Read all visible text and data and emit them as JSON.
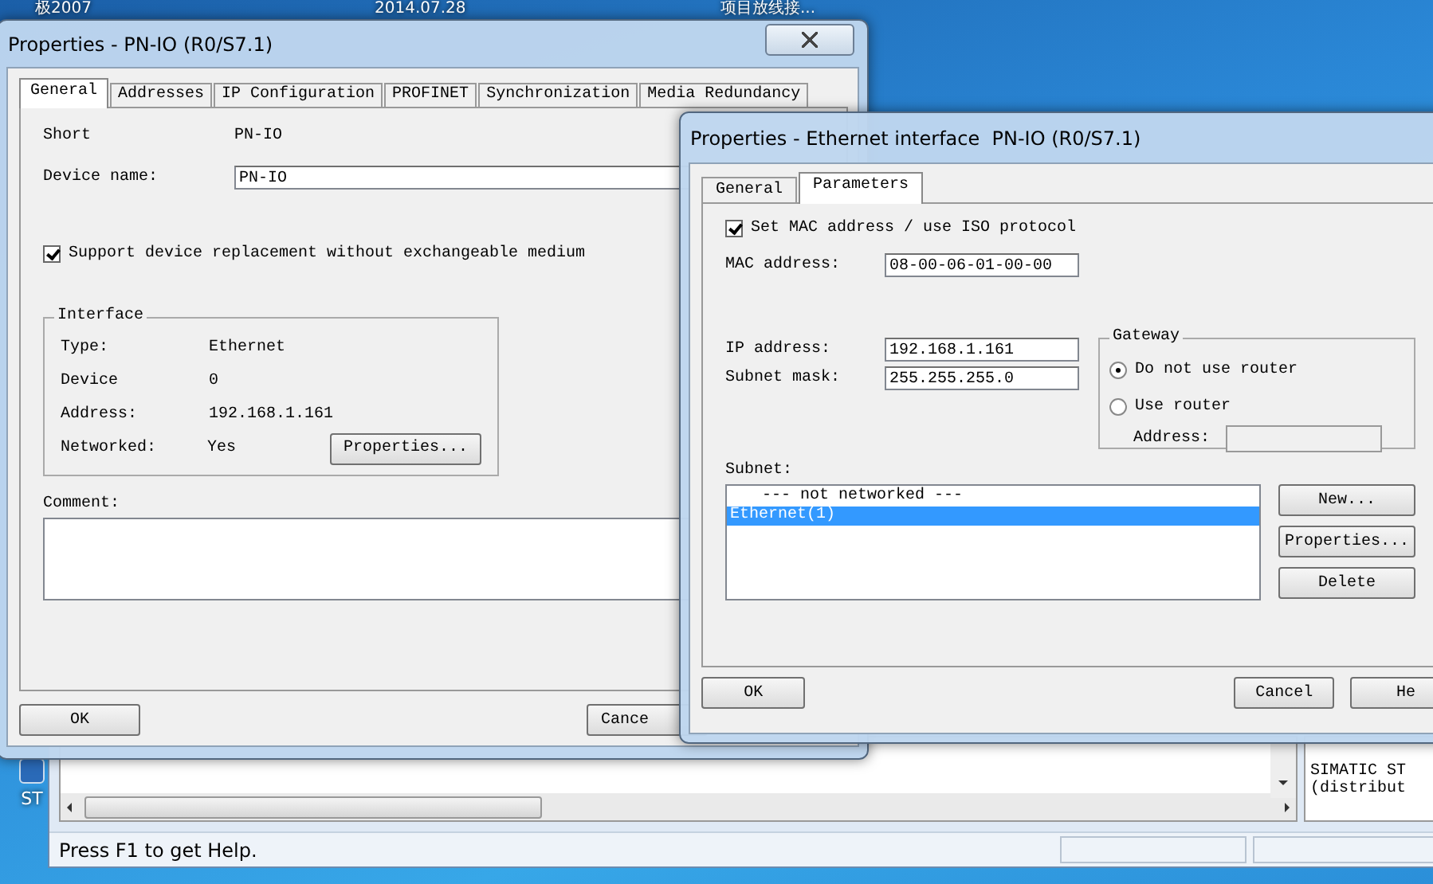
{
  "desktop_labels": [
    "极2007",
    "2014.07.28",
    "项目放线接..."
  ],
  "desktop_icon": {
    "label": "ST"
  },
  "main_window": {
    "side_panel": [
      "SIMATIC ST",
      "(distribut"
    ],
    "status_bar": "Press F1 to get Help."
  },
  "general_dialog": {
    "title": "Properties - PN-IO (R0/S7.1)",
    "tabs": [
      {
        "label": "General",
        "selected": true
      },
      {
        "label": "Addresses",
        "selected": false
      },
      {
        "label": "IP Configuration",
        "selected": false
      },
      {
        "label": "PROFINET",
        "selected": false
      },
      {
        "label": "Synchronization",
        "selected": false
      },
      {
        "label": "Media Redundancy",
        "selected": false
      }
    ],
    "short": {
      "label": "Short",
      "value": "PN-IO"
    },
    "device_name": {
      "label": "Device name:",
      "value": "PN-IO"
    },
    "replacement": {
      "label": "Support device replacement without exchangeable medium",
      "checked": true
    },
    "interface": {
      "title": "Interface",
      "rows": [
        {
          "label": "Type:",
          "value": "Ethernet"
        },
        {
          "label": "Device",
          "value": "0"
        },
        {
          "label": "Address:",
          "value": "192.168.1.161"
        },
        {
          "label": "Networked:",
          "value": "Yes"
        }
      ],
      "button": "Properties..."
    },
    "comment_label": "Comment:",
    "buttons": [
      "OK",
      "Cance"
    ]
  },
  "ethernet_dialog": {
    "title": "Properties - Ethernet interface  PN-IO (R0/S7.1)",
    "tabs": [
      {
        "label": "General",
        "selected": false
      },
      {
        "label": "Parameters",
        "selected": true
      }
    ],
    "mac_option": {
      "label": "Set MAC address / use ISO protocol",
      "checked": true
    },
    "mac_address": {
      "label": "MAC address:",
      "value": "08-00-06-01-00-00"
    },
    "ip_address": {
      "label": "IP address:",
      "value": "192.168.1.161"
    },
    "subnet_mask": {
      "label": "Subnet mask:",
      "value": "255.255.255.0"
    },
    "gateway": {
      "title": "Gateway",
      "options": [
        {
          "label": "Do not use router",
          "selected": true
        },
        {
          "label": "Use router",
          "selected": false
        }
      ],
      "address_label": "Address:",
      "address_disabled": true
    },
    "subnet_label": "Subnet:",
    "subnets": [
      {
        "label": "--- not networked ---",
        "selected": false
      },
      {
        "label": "Ethernet(1)",
        "selected": true
      }
    ],
    "subnet_buttons": [
      "New...",
      "Properties...",
      "Delete"
    ],
    "buttons": [
      "OK",
      "Cancel",
      "He"
    ]
  }
}
